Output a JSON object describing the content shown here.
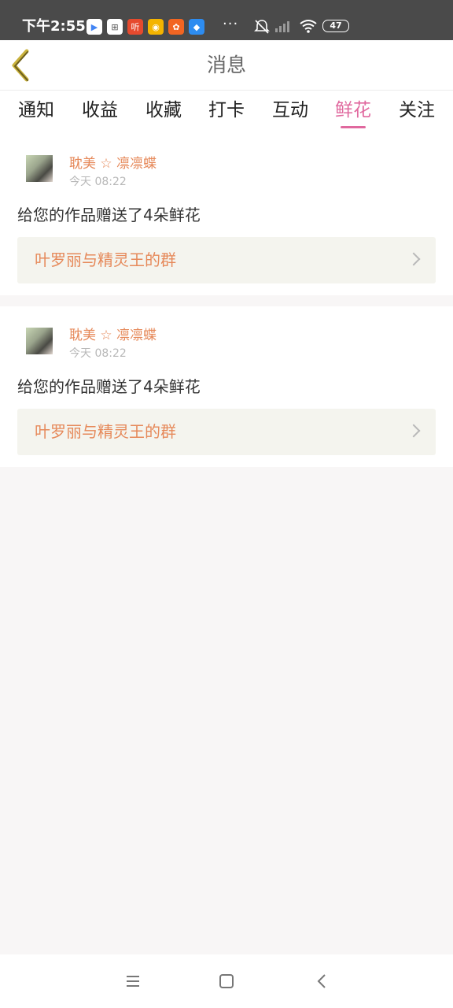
{
  "status_bar": {
    "time": "下午2:55",
    "app_icons": [
      {
        "name": "play-store-icon",
        "glyph": "▶",
        "color": "#ffffff"
      },
      {
        "name": "mall-icon",
        "glyph": "⊞",
        "color": "#ffffff"
      },
      {
        "name": "listen-app-icon",
        "glyph": "听",
        "color": "#e64a2e"
      },
      {
        "name": "weibo-icon",
        "glyph": "◉",
        "color": "#f4b400"
      },
      {
        "name": "kuaishou-icon",
        "glyph": "✿",
        "color": "#f26522"
      },
      {
        "name": "message-app-icon",
        "glyph": "◆",
        "color": "#2d8cf0"
      }
    ],
    "more": "···",
    "battery": "47"
  },
  "header": {
    "title": "消息"
  },
  "tabs": [
    {
      "label": "通知",
      "active": false
    },
    {
      "label": "收益",
      "active": false
    },
    {
      "label": "收藏",
      "active": false
    },
    {
      "label": "打卡",
      "active": false
    },
    {
      "label": "互动",
      "active": false
    },
    {
      "label": "鲜花",
      "active": true
    },
    {
      "label": "关注",
      "active": false
    }
  ],
  "messages": [
    {
      "username": "耽美 ☆ 凛凛蝶",
      "time": "今天 08:22",
      "text": "给您的作品赠送了4朵鲜花",
      "group": "叶罗丽与精灵王的群"
    },
    {
      "username": "耽美 ☆ 凛凛蝶",
      "time": "今天 08:22",
      "text": "给您的作品赠送了4朵鲜花",
      "group": "叶罗丽与精灵王的群"
    }
  ],
  "colors": {
    "accent": "#e0689e",
    "username": "#e6895a",
    "link_bg": "#f4f4ee"
  }
}
